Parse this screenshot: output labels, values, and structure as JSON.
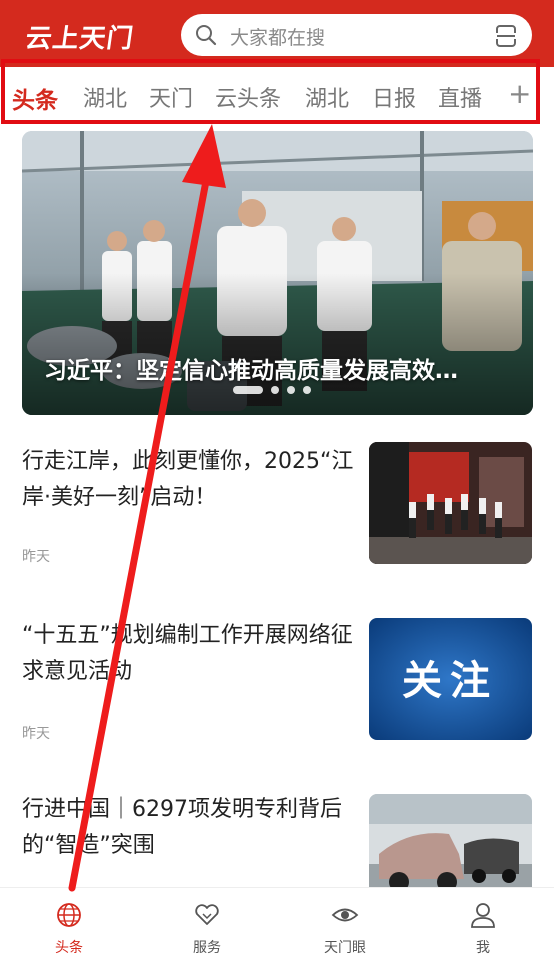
{
  "header": {
    "logo": "云上天门",
    "search_placeholder": "大家都在搜",
    "bg_color": "#d42a1e"
  },
  "tabs": {
    "items": [
      "头条",
      "湖北",
      "天门",
      "云头条",
      "湖北",
      "日报",
      "直播"
    ],
    "active": 0,
    "more": "+"
  },
  "banner": {
    "title": "习近平：坚定信心推动高质量发展高效…",
    "slides": 4,
    "current": 0
  },
  "news": [
    {
      "title": "行走江岸，此刻更懂你，2025“江岸·美好一刻”启动！",
      "time": "昨天"
    },
    {
      "title": "“十五五”规划编制工作开展网络征求意见活动",
      "time": "昨天",
      "thumb_text": "关注"
    },
    {
      "title": "行进中国｜6297项发明专利背后的“智造”突围",
      "time": ""
    }
  ],
  "bottom_nav": [
    {
      "label": "头条",
      "icon": "globe-icon",
      "active": true
    },
    {
      "label": "服务",
      "icon": "heart-icon",
      "active": false
    },
    {
      "label": "天门眼",
      "icon": "eye-icon",
      "active": false
    },
    {
      "label": "我",
      "icon": "user-icon",
      "active": false
    }
  ]
}
